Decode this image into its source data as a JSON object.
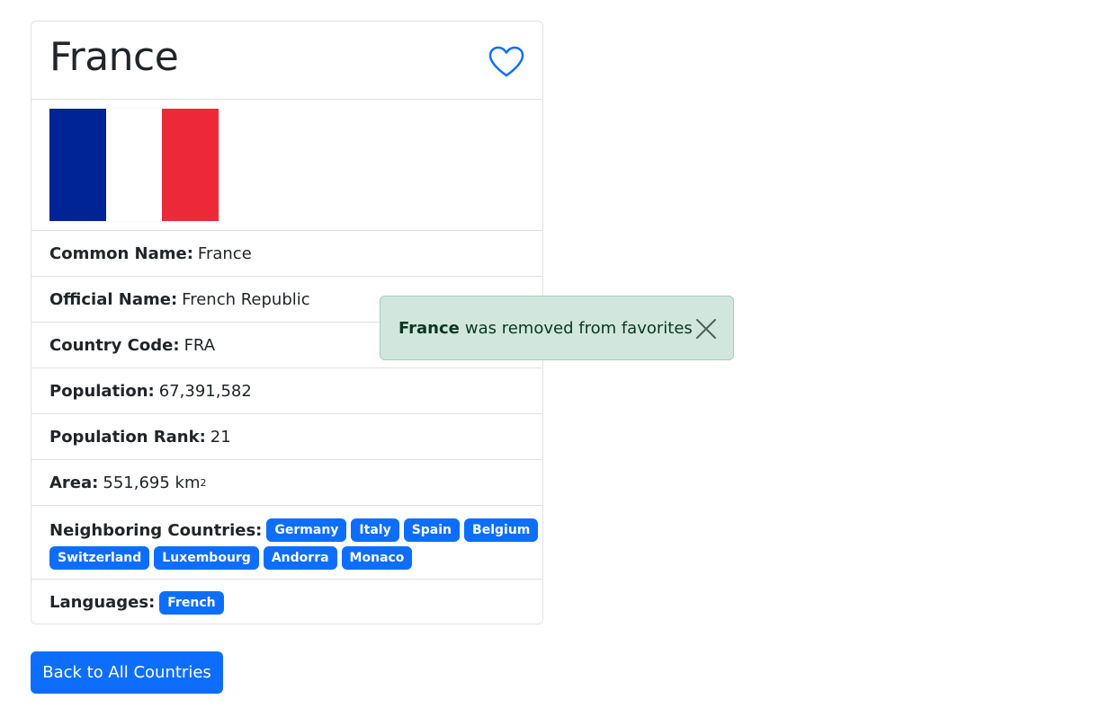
{
  "country": {
    "title": "France",
    "flag": {
      "colors": [
        "#002395",
        "#ffffff",
        "#ed2939"
      ]
    }
  },
  "favorite": {
    "icon": "heart-outline-icon",
    "color": "#0d6efd"
  },
  "details": {
    "common_name": {
      "label": "Common Name:",
      "value": "France"
    },
    "official_name": {
      "label": "Official Name:",
      "value": "French Republic"
    },
    "country_code": {
      "label": "Country Code:",
      "value": "FRA"
    },
    "population": {
      "label": "Population:",
      "value": "67,391,582"
    },
    "population_rank": {
      "label": "Population Rank:",
      "value": "21"
    },
    "area": {
      "label": "Area:",
      "value": "551,695 km",
      "unit_sup": "2"
    }
  },
  "neighbors": {
    "label": "Neighboring Countries:",
    "items": [
      "Germany",
      "Italy",
      "Spain",
      "Belgium",
      "Switzerland",
      "Luxembourg",
      "Andorra",
      "Monaco"
    ]
  },
  "languages": {
    "label": "Languages:",
    "items": [
      "French"
    ]
  },
  "back_button": {
    "label": "Back to All Countries"
  },
  "toast": {
    "country": "France",
    "message": "was removed from favorites",
    "close_icon": "close-icon",
    "bg_color": "#d1e7dd"
  },
  "colors": {
    "primary": "#0d6efd",
    "border": "#dee2e6",
    "text": "#212529"
  }
}
